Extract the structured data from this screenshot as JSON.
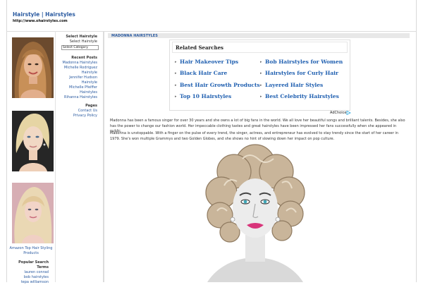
{
  "site": {
    "title": "Hairstyle | Hairstyles",
    "url": "http://www.ohairstyles.com"
  },
  "left": {
    "amazon_link": "Amazon Top Hair Styling Products",
    "popular_title": "Popular Search Terms",
    "popular_items": [
      "lauren conrad",
      "bob hairstyles",
      "tepa williamson"
    ]
  },
  "sidebar": {
    "select_title": "Select Hairstyle",
    "select_sub": "Select Hairstyle",
    "select_value": "Select Category",
    "recent_title": "Recent Posts",
    "recent": [
      "Madonna Hairstyles",
      "Michelle Rodriguez",
      "Hairstyle",
      "Jennifer Hudson",
      "Hairstyle",
      "Michelle Pfeiffer",
      "Hairstyles",
      "Rihanna Hairstyles"
    ],
    "pages_title": "Pages",
    "pages": [
      "Contact Us",
      "Privacy Policy"
    ]
  },
  "main": {
    "section_title": "MADONNA HAIRSTYLES",
    "ad": {
      "heading": "Related Searches",
      "links": [
        "Hair Makeover Tips",
        "Bob Hairstyles for Women",
        "Black Hair Care",
        "Hairstyles for Curly Hair",
        "Best Hair Growth Products",
        "Layered Hair Styles",
        "Top 10 Hairstyles",
        "Best Celebrity Hairstyles"
      ],
      "adchoices": "AdChoices"
    },
    "paragraphs": [
      "Madonna has been a famous singer for over 30 years and she owns a lot of big fans in the world. We all love her beautiful songs and brilliant talents. Besides, she also has the power to change our fashion world. Her impeccable clothing tastes and great hairstyles have been impressed her fans successfully when she appeared in public.",
      "Madonna is unstoppable. With a finger on the pulse of every trend, the singer, actress, and entrepreneur has evolved to stay trendy since the start of her career in 1979. She's won multiple Grammys and two Golden Globes, and she shows no hint of slowing down her impact on pop culture."
    ]
  }
}
